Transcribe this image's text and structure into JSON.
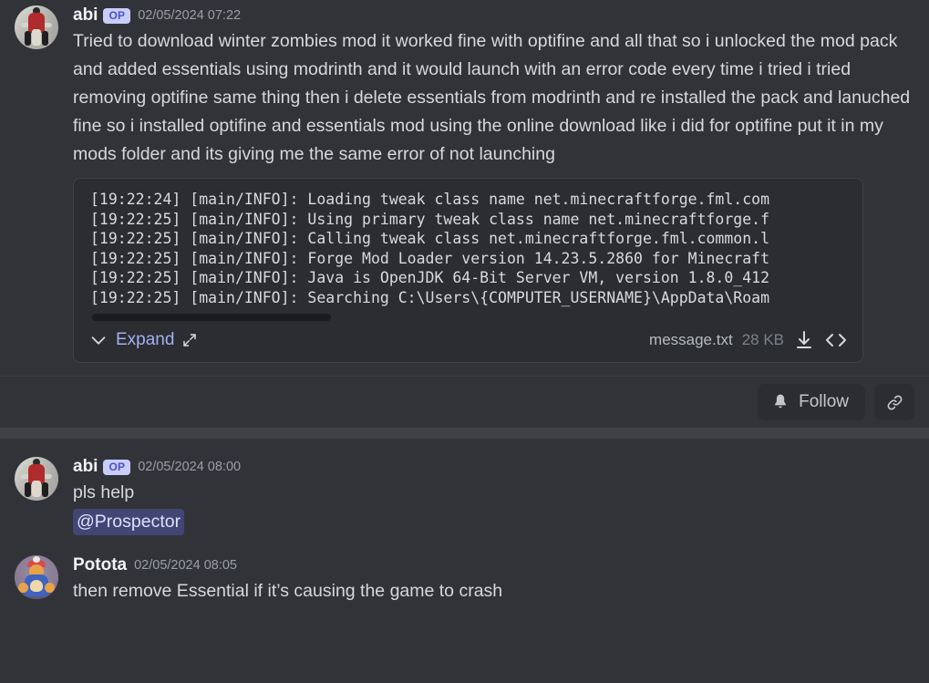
{
  "messages": [
    {
      "author": "abi",
      "badge": "OP",
      "timestamp": "02/05/2024 07:22",
      "text": "Tried to download winter zombies mod it worked fine with optifine and all that so i unlocked the mod pack and added essentials using modrinth and it would launch with an error code every time i tried i tried removing optifine same thing then i delete essentials from modrinth and re installed the pack and lanuched fine so i installed optifine and essentials mod using the online download like i did for optifine put it in my mods folder and its giving me the same error of not launching"
    },
    {
      "author": "abi",
      "badge": "OP",
      "timestamp": "02/05/2024 08:00",
      "text": "pls help",
      "mention": "@Prospector"
    },
    {
      "author": "Potota",
      "timestamp": "02/05/2024 08:05",
      "text": "then remove Essential if it’s causing the game to crash"
    }
  ],
  "attachment": {
    "code_lines": [
      "[19:22:24] [main/INFO]: Loading tweak class name net.minecraftforge.fml.com",
      "[19:22:25] [main/INFO]: Using primary tweak class name net.minecraftforge.f",
      "[19:22:25] [main/INFO]: Calling tweak class net.minecraftforge.fml.common.l",
      "[19:22:25] [main/INFO]: Forge Mod Loader version 14.23.5.2860 for Minecraft",
      "[19:22:25] [main/INFO]: Java is OpenJDK 64-Bit Server VM, version 1.8.0_412",
      "[19:22:25] [main/INFO]: Searching C:\\Users\\{COMPUTER_USERNAME}\\AppData\\Roam"
    ],
    "expand_label": "Expand",
    "file_name": "message.txt",
    "file_size": "28 KB",
    "icons": {
      "chevron": "chevron-down-icon",
      "fullscreen": "expand-arrows-icon",
      "download": "download-icon",
      "code": "code-brackets-icon"
    }
  },
  "thread_actions": {
    "follow_label": "Follow",
    "bell_icon": "bell-icon",
    "link_icon": "link-icon"
  },
  "colors": {
    "background": "#313338",
    "attachment_bg": "#2b2d31",
    "badge_bg": "#c9cdfb",
    "badge_text": "#4953c6",
    "mention_bg": "#414675",
    "mention_text": "#dee0fc",
    "expand_link": "#a5aef5",
    "divider": "#3f4147"
  }
}
